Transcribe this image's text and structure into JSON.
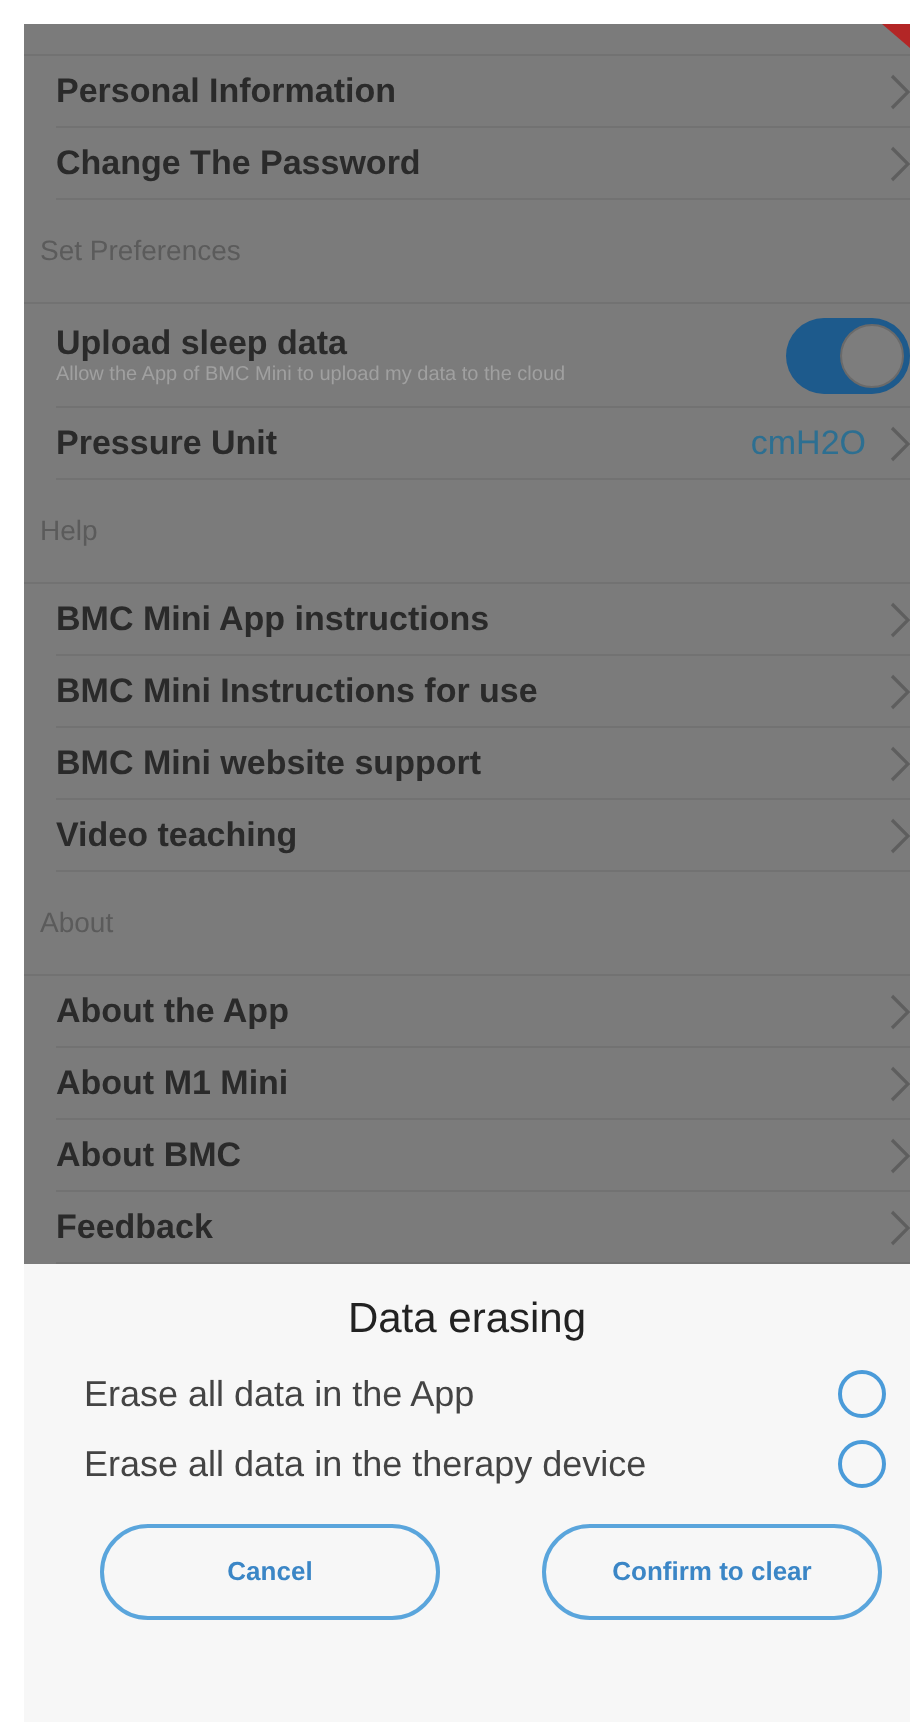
{
  "sections": [
    {
      "items": [
        {
          "kind": "link",
          "label": "Personal Information"
        },
        {
          "kind": "link",
          "label": "Change The Password"
        }
      ]
    },
    {
      "title": "Set Preferences",
      "items": [
        {
          "kind": "toggle",
          "label": "Upload sleep data",
          "description": "Allow the App of BMC Mini to upload my data to the cloud",
          "on": true
        },
        {
          "kind": "value",
          "label": "Pressure Unit",
          "value": "cmH2O"
        }
      ]
    },
    {
      "title": "Help",
      "items": [
        {
          "kind": "link",
          "label": "BMC Mini App instructions"
        },
        {
          "kind": "link",
          "label": "BMC Mini Instructions for use"
        },
        {
          "kind": "link",
          "label": "BMC Mini website support"
        },
        {
          "kind": "link",
          "label": "Video teaching"
        }
      ]
    },
    {
      "title": "About",
      "items": [
        {
          "kind": "link",
          "label": "About the App"
        },
        {
          "kind": "link",
          "label": "About M1 Mini"
        },
        {
          "kind": "link",
          "label": "About BMC"
        },
        {
          "kind": "link",
          "label": "Feedback"
        }
      ]
    }
  ],
  "dialog": {
    "title": "Data erasing",
    "options": [
      {
        "label": "Erase all data in the App",
        "selected": false
      },
      {
        "label": "Erase all data in the therapy device",
        "selected": false
      }
    ],
    "buttons": [
      "Cancel",
      "Confirm to clear"
    ]
  }
}
